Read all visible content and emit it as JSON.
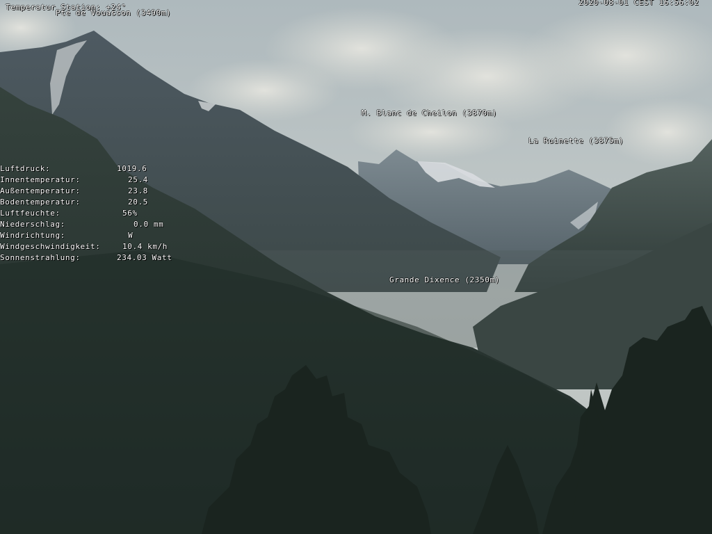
{
  "header": {
    "station_temperature": "Temperatur Station: +24°",
    "timestamp": "2020-08-01 CEST 16:56:02"
  },
  "peaks": [
    {
      "id": "pte-de-vouasson",
      "label": "Pte de Vouasson (3490m)"
    },
    {
      "id": "mont-blanc-de-cheilon",
      "label": "M. Blanc de Cheilon (3870m)"
    },
    {
      "id": "la-ruinette",
      "label": "La Ruinette (3875m)"
    },
    {
      "id": "grande-dixence",
      "label": "Grande Dixence (2350m)"
    }
  ],
  "weather": {
    "rows": [
      {
        "label": "Luftdruck:",
        "value": "1019.6"
      },
      {
        "label": "Innentemperatur:",
        "value": "25.4"
      },
      {
        "label": "Außentemperatur:",
        "value": "23.8"
      },
      {
        "label": "Bodentemperatur:",
        "value": "20.5"
      },
      {
        "label": "Luftfeuchte:",
        "value": "56%"
      },
      {
        "label": "Niederschlag:",
        "value": "0.0 mm"
      },
      {
        "label": "Windrichtung:",
        "value": "W"
      },
      {
        "label": "Windgeschwindigkeit:",
        "value": "10.4 km/h"
      },
      {
        "label": "Sonnenstrahlung:",
        "value": "234.03 Watt"
      }
    ]
  },
  "colors": {
    "sky_top": "#b9c4c6",
    "sky_bottom": "#c9cfcc",
    "far_mountains": "#6d7a82",
    "mid_mountains": "#4a5759",
    "forest": "#24302c",
    "tree_silhouette": "#1c2721"
  }
}
